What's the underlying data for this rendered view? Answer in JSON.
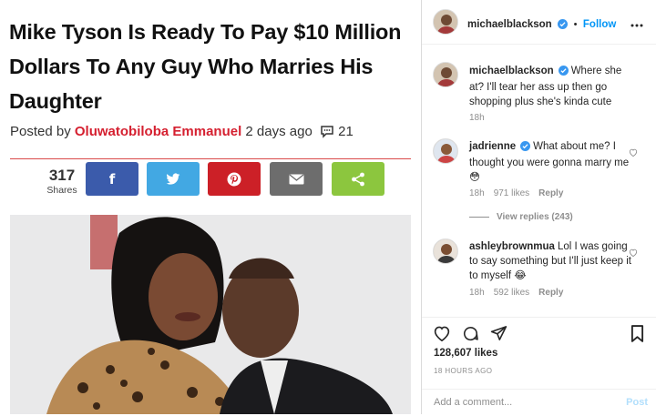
{
  "article": {
    "headline": "Mike Tyson Is Ready To Pay $10 Million Dollars To Any Guy Who Marries His Daughter",
    "posted_by_prefix": "Posted by",
    "author": "Oluwatobiloba Emmanuel",
    "posted_time": "2 days ago",
    "comment_count": "21",
    "share_count": "317",
    "share_label": "Shares",
    "share_buttons": [
      {
        "name": "facebook",
        "glyph": "f",
        "color": "#3b5bab"
      },
      {
        "name": "twitter",
        "icon": "twitter-bird-icon",
        "color": "#42a8e3"
      },
      {
        "name": "pinterest",
        "icon": "pinterest-icon",
        "color": "#cc2027"
      },
      {
        "name": "email",
        "icon": "envelope-icon",
        "color": "#6d6d6d"
      },
      {
        "name": "share",
        "icon": "share-icon",
        "color": "#8cc63e"
      }
    ]
  },
  "instagram": {
    "header": {
      "username": "michaelblackson",
      "separator": "•",
      "follow_label": "Follow"
    },
    "caption": {
      "username": "michaelblackson",
      "text": "Where she at? I'll tear her ass up then go shopping plus she's kinda cute",
      "time": "18h"
    },
    "comments": [
      {
        "username": "jadrienne",
        "verified": true,
        "text": "What about me? I thought you were gonna marry me 😳",
        "time": "18h",
        "likes": "971 likes",
        "reply": "Reply",
        "view_replies": "View replies (243)"
      },
      {
        "username": "ashleybrownmua",
        "verified": false,
        "text": "Lol I was going to say something but I'll just keep it to myself 😂",
        "time": "18h",
        "likes": "592 likes",
        "reply": "Reply"
      }
    ],
    "likes_count": "128,607 likes",
    "time_ago": "18 HOURS AGO",
    "add_comment_placeholder": "Add a comment...",
    "post_label": "Post",
    "colors": {
      "follow": "#0095f6",
      "verified": "#3897f0",
      "author": "#d52030"
    }
  }
}
